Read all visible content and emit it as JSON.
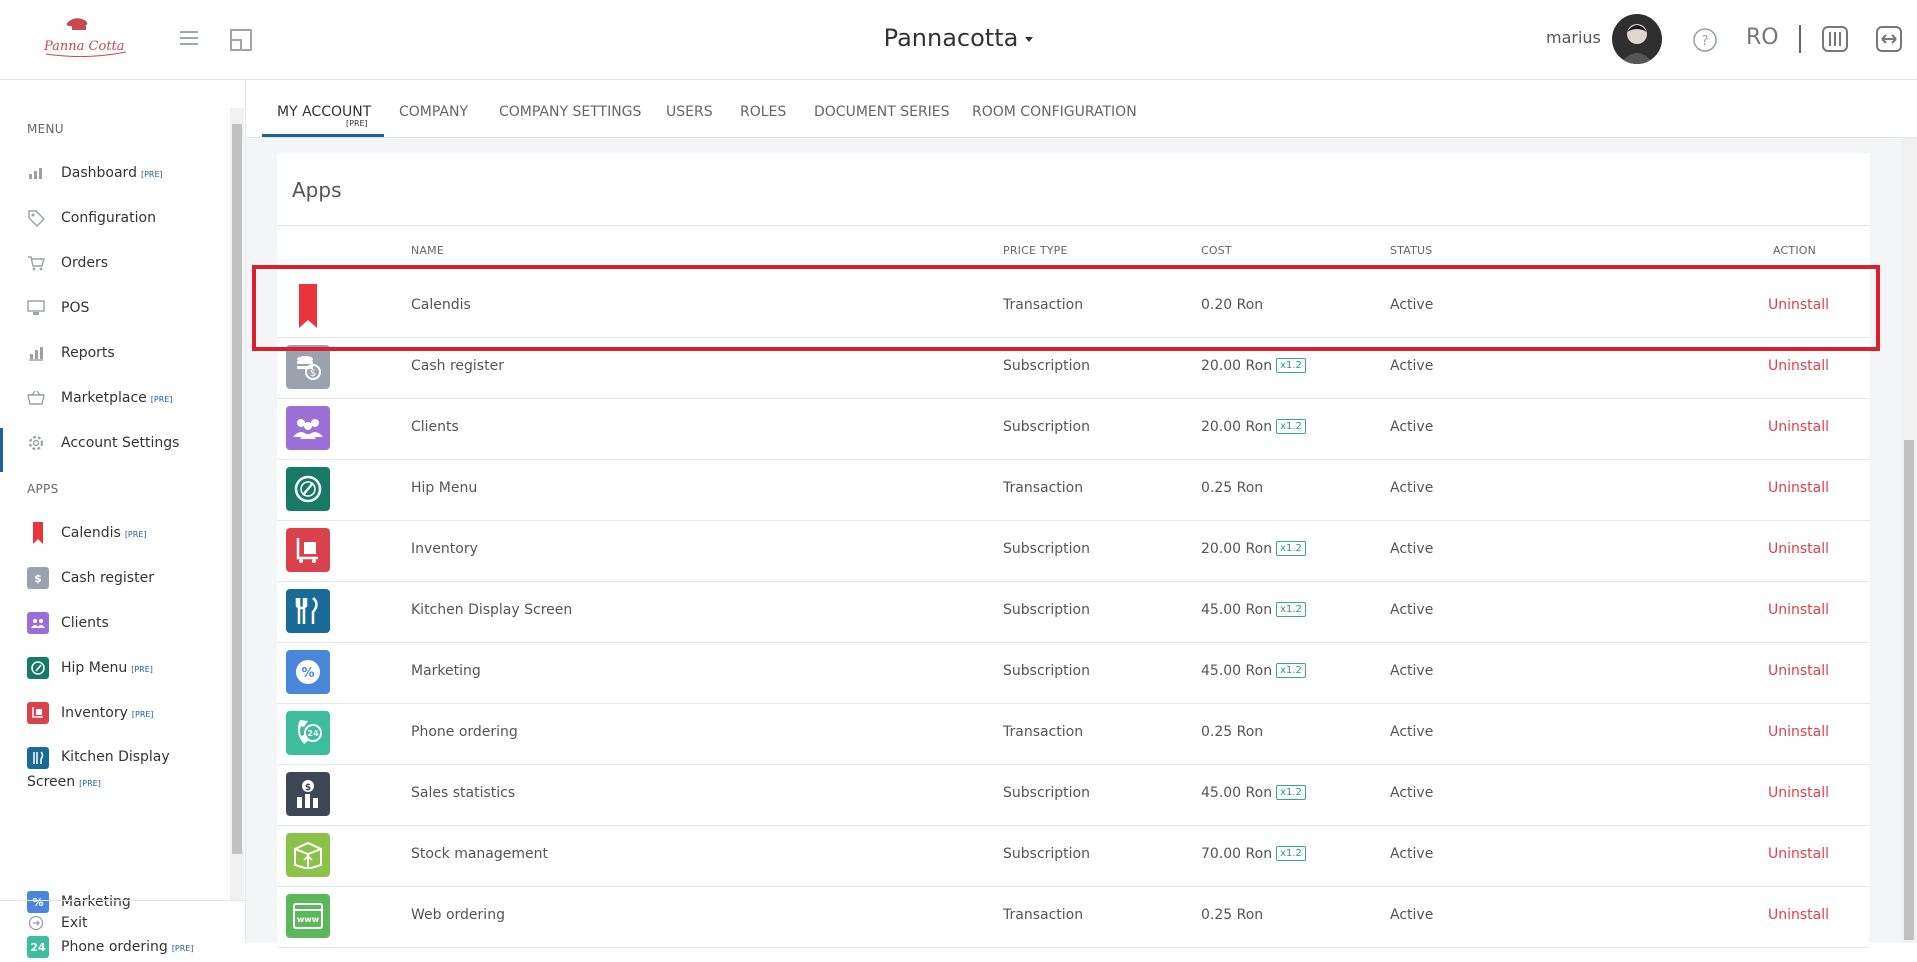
{
  "header": {
    "brand": "Pannacotta",
    "username": "marius",
    "language": "RO",
    "logo_text": "Panna Cotta"
  },
  "sidebar": {
    "menu_title": "MENU",
    "apps_title": "APPS",
    "menu_items": [
      {
        "label": "Dashboard",
        "pre": "[PRE]",
        "icon": "chart-icon"
      },
      {
        "label": "Configuration",
        "pre": "",
        "icon": "tag-icon"
      },
      {
        "label": "Orders",
        "pre": "",
        "icon": "cart-icon"
      },
      {
        "label": "POS",
        "pre": "",
        "icon": "monitor-icon"
      },
      {
        "label": "Reports",
        "pre": "",
        "icon": "bar-chart-icon"
      },
      {
        "label": "Marketplace",
        "pre": "[PRE]",
        "icon": "basket-icon"
      },
      {
        "label": "Account Settings",
        "pre": "",
        "icon": "gear-icon"
      }
    ],
    "app_items": [
      {
        "label": "Calendis",
        "pre": "[PRE]",
        "color": "#e8343a"
      },
      {
        "label": "Cash register",
        "pre": "",
        "color": "#9aa3ad"
      },
      {
        "label": "Clients",
        "pre": "",
        "color": "#9a6fd6"
      },
      {
        "label": "Hip Menu",
        "pre": "[PRE]",
        "color": "#177a67"
      },
      {
        "label": "Inventory",
        "pre": "[PRE]",
        "color": "#d9424c"
      },
      {
        "label": "Kitchen Display",
        "label2": "Screen",
        "pre": "[PRE]",
        "color": "#1a6c98"
      },
      {
        "label": "Marketing",
        "pre": "",
        "color": "#4a86d9"
      },
      {
        "label": "Phone ordering",
        "pre": "[PRE]",
        "color": "#3dbd9d"
      }
    ],
    "exit_label": "Exit"
  },
  "tabs": {
    "items": [
      "MY ACCOUNT",
      "COMPANY",
      "COMPANY SETTINGS",
      "USERS",
      "ROLES",
      "DOCUMENT SERIES",
      "ROOM CONFIGURATION"
    ],
    "active_pre": "[PRE]"
  },
  "apps": {
    "title": "Apps",
    "columns": {
      "name": "NAME",
      "price_type": "PRICE TYPE",
      "cost": "COST",
      "status": "STATUS",
      "action": "ACTION"
    },
    "rows": [
      {
        "name": "Calendis",
        "price_type": "Transaction",
        "cost": "0.20 Ron",
        "badge": "",
        "status": "Active",
        "action": "Uninstall",
        "icon": "bookmark-icon",
        "color": "#e8343a"
      },
      {
        "name": "Cash register",
        "price_type": "Subscription",
        "cost": "20.00 Ron",
        "badge": "x1.2",
        "status": "Active",
        "action": "Uninstall",
        "icon": "coins-icon",
        "color": "#9aa3ad"
      },
      {
        "name": "Clients",
        "price_type": "Subscription",
        "cost": "20.00 Ron",
        "badge": "x1.2",
        "status": "Active",
        "action": "Uninstall",
        "icon": "people-icon",
        "color": "#9a6fd6"
      },
      {
        "name": "Hip Menu",
        "price_type": "Transaction",
        "cost": "0.25 Ron",
        "badge": "",
        "status": "Active",
        "action": "Uninstall",
        "icon": "dish-icon",
        "color": "#177a67"
      },
      {
        "name": "Inventory",
        "price_type": "Subscription",
        "cost": "20.00 Ron",
        "badge": "x1.2",
        "status": "Active",
        "action": "Uninstall",
        "icon": "trolley-icon",
        "color": "#d9424c"
      },
      {
        "name": "Kitchen Display Screen",
        "price_type": "Subscription",
        "cost": "45.00 Ron",
        "badge": "x1.2",
        "status": "Active",
        "action": "Uninstall",
        "icon": "cutlery-icon",
        "color": "#1a6c98"
      },
      {
        "name": "Marketing",
        "price_type": "Subscription",
        "cost": "45.00 Ron",
        "badge": "x1.2",
        "status": "Active",
        "action": "Uninstall",
        "icon": "percent-icon",
        "color": "#4a86d9"
      },
      {
        "name": "Phone ordering",
        "price_type": "Transaction",
        "cost": "0.25 Ron",
        "badge": "",
        "status": "Active",
        "action": "Uninstall",
        "icon": "phone-24-icon",
        "color": "#3dbd9d"
      },
      {
        "name": "Sales statistics",
        "price_type": "Subscription",
        "cost": "45.00 Ron",
        "badge": "x1.2",
        "status": "Active",
        "action": "Uninstall",
        "icon": "stats-icon",
        "color": "#3f4654"
      },
      {
        "name": "Stock management",
        "price_type": "Subscription",
        "cost": "70.00 Ron",
        "badge": "x1.2",
        "status": "Active",
        "action": "Uninstall",
        "icon": "box-icon",
        "color": "#8bc34a"
      },
      {
        "name": "Web ordering",
        "price_type": "Transaction",
        "cost": "0.25 Ron",
        "badge": "",
        "status": "Active",
        "action": "Uninstall",
        "icon": "www-icon",
        "color": "#5cb85c"
      }
    ]
  }
}
